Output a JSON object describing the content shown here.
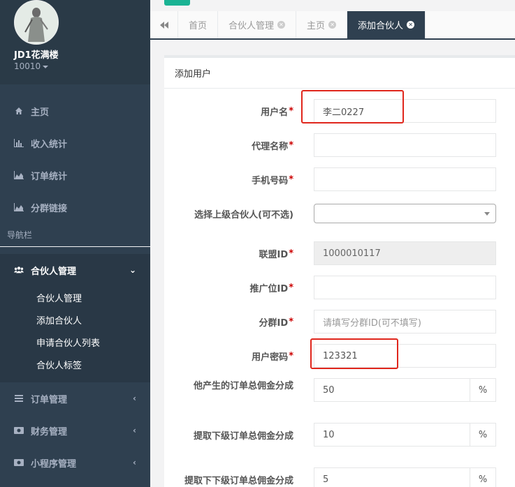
{
  "profile": {
    "name": "JD1花满楼",
    "id": "10010"
  },
  "sidebar": {
    "items": [
      {
        "label": "主页",
        "icon": "home-icon"
      },
      {
        "label": "收入统计",
        "icon": "bar-chart-icon"
      },
      {
        "label": "订单统计",
        "icon": "area-chart-icon"
      },
      {
        "label": "分群链接",
        "icon": "area-chart-icon"
      }
    ],
    "section_label": "导航栏",
    "active_group": {
      "label": "合伙人管理",
      "icon": "users-icon",
      "subitems": [
        "合伙人管理",
        "添加合伙人",
        "申请合伙人列表",
        "合伙人标签"
      ]
    },
    "more": [
      {
        "label": "订单管理",
        "icon": "list-icon"
      },
      {
        "label": "财务管理",
        "icon": "money-icon"
      },
      {
        "label": "小程序管理",
        "icon": "money-icon"
      }
    ]
  },
  "tabs": [
    {
      "label": "首页",
      "closable": false
    },
    {
      "label": "合伙人管理",
      "closable": true
    },
    {
      "label": "主页",
      "closable": true
    },
    {
      "label": "添加合伙人",
      "closable": true,
      "active": true
    }
  ],
  "panel": {
    "title": "添加用户"
  },
  "form": {
    "username": {
      "label": "用户名",
      "value": "李二0227"
    },
    "agent_name": {
      "label": "代理名称",
      "value": ""
    },
    "phone": {
      "label": "手机号码",
      "value": ""
    },
    "parent": {
      "label": "选择上级合伙人(可不选)",
      "value": ""
    },
    "union_id": {
      "label": "联盟ID",
      "value": "1000010117"
    },
    "promo_id": {
      "label": "推广位ID",
      "value": ""
    },
    "group_id": {
      "label": "分群ID",
      "placeholder": "请填写分群ID(可不填写)"
    },
    "password": {
      "label": "用户密码",
      "value": "123321"
    },
    "commission_own": {
      "label": "他产生的订单总佣金分成",
      "value": "50",
      "unit": "%"
    },
    "commission_sub": {
      "label": "提取下级订单总佣金分成",
      "value": "10",
      "unit": "%"
    },
    "commission_subsub": {
      "label": "提取下下级订单总佣金分成",
      "value": "5",
      "unit": "%"
    }
  },
  "colors": {
    "sidebar": "#2f4050",
    "accent": "#1ab394",
    "highlight": "#e0261c",
    "required": "#cc0000"
  }
}
